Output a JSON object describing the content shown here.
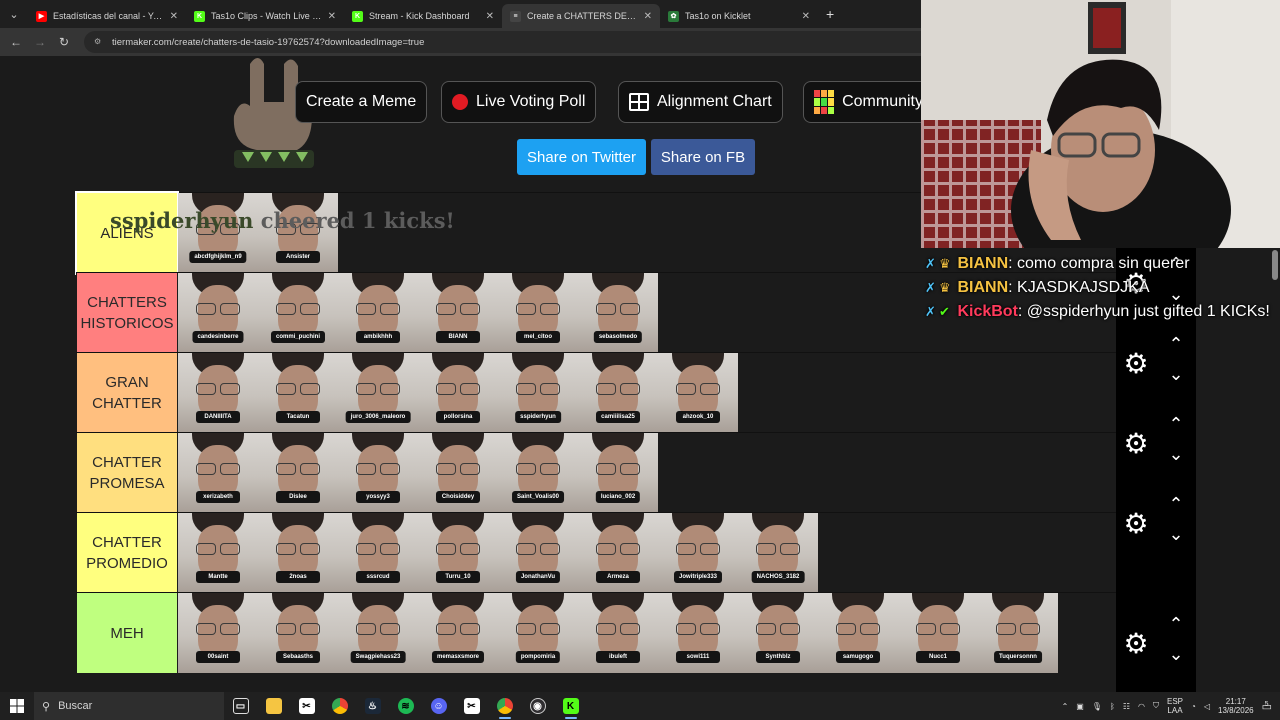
{
  "browser": {
    "tabs": [
      {
        "title": "Estadísticas del canal - YouTube",
        "fav_color": "#ff0000",
        "fav": "▶",
        "active": false
      },
      {
        "title": "Tas1o Clips - Watch Live on Kick",
        "fav_color": "#53fc18",
        "fav": "K",
        "active": false
      },
      {
        "title": "Stream - Kick Dashboard",
        "fav_color": "#53fc18",
        "fav": "K",
        "active": false
      },
      {
        "title": "Create a CHATTERS DE TASIO T",
        "fav_color": "#444444",
        "fav": "≡",
        "active": true
      },
      {
        "title": "Tas1o on Kicklet",
        "fav_color": "#2a7a3a",
        "fav": "✿",
        "active": false
      }
    ],
    "url": "tiermaker.com/create/chatters-de-tasio-19762574?downloadedImage=true"
  },
  "page": {
    "top_buttons": {
      "meme": "Create a Meme",
      "poll": "Live Voting Poll",
      "alignment": "Alignment Chart",
      "community": "Community"
    },
    "share": {
      "twitter": "Share on Twitter",
      "fb": "Share on FB"
    },
    "cheer_overlay": {
      "user": "sspiderhyun",
      "text": "cheered 1 kicks!"
    }
  },
  "tiers": [
    {
      "label": "ALIENS",
      "color": "#ffff7f",
      "items": [
        "abcdfghijklm_n9",
        "Ansister"
      ]
    },
    {
      "label": "CHATTERS HISTORICOS",
      "color": "#ff7f7f",
      "items": [
        "candesinberre",
        "commi_puchini",
        "ambikhhh",
        "BIANN",
        "mel_citoo",
        "sebasolmedo"
      ]
    },
    {
      "label": "GRAN CHATTER",
      "color": "#ffbf7f",
      "items": [
        "DANIIIITA",
        "Tacatun",
        "juro_3006_maleoro",
        "pollorsina",
        "sspiderhyun",
        "camiiilisa25",
        "ahzook_10"
      ]
    },
    {
      "label": "CHATTER PROMESA",
      "color": "#ffdf7f",
      "items": [
        "xerizabeth",
        "Dislee",
        "yossyy3",
        "Choisiddey",
        "Saint_Voalis00",
        "luciano_002"
      ]
    },
    {
      "label": "CHATTER PROMEDIO",
      "color": "#ffff7f",
      "items": [
        "Mantte",
        "2noas",
        "sssrcud",
        "Turru_10",
        "JonathanVu",
        "Armeza",
        "Jowitriple333",
        "NACHOS_3182"
      ]
    },
    {
      "label": "MEH",
      "color": "#bfff7f",
      "items": [
        "00saint",
        "Sebaasths",
        "Swagpiehass23",
        "memasxsmore",
        "pompomiria",
        "ibuleft",
        "sowi111",
        "Synthblz",
        "samugogo",
        "Nucc1",
        "Tuquersonnn"
      ]
    }
  ],
  "chat": [
    {
      "user": "BIANN",
      "user_color": "#f5c242",
      "badges": [
        "✗",
        "♛"
      ],
      "message": "como compra sin querer"
    },
    {
      "user": "BIANN",
      "user_color": "#f5c242",
      "badges": [
        "✗",
        "♛"
      ],
      "message": "KJASDKAJSDJKA"
    },
    {
      "user": "KickBot",
      "user_color": "#ff3b5c",
      "badges": [
        "✗",
        "✔"
      ],
      "message": "@sspiderhyun just gifted 1 KICKs!"
    }
  ],
  "taskbar": {
    "search_placeholder": "Buscar",
    "lang_top": "ESP",
    "lang_bottom": "LAA",
    "time": "21:17",
    "date": "13/8/2026",
    "notif_count": "5"
  }
}
